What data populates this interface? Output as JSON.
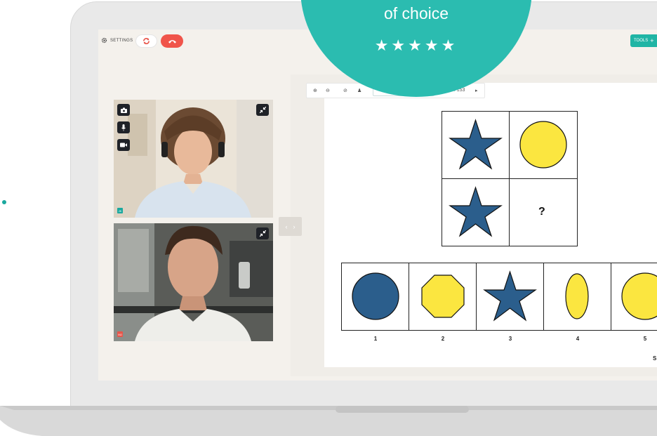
{
  "badge": {
    "text": "of choice",
    "stars": "★★★★★"
  },
  "topbar": {
    "settings_label": "SETTINGS",
    "tools_label": "TOOLS",
    "tools_plus": "+"
  },
  "participants": [
    {
      "initials": "JK",
      "initials_color": "#1aa89e"
    },
    {
      "initials": "MJ",
      "initials_color": "#e8564b"
    }
  ],
  "toolbar": {
    "page_counter": "1 / 153",
    "next_arrow": "▸"
  },
  "nav": {
    "prev": "‹",
    "next": "›"
  },
  "puzzle": {
    "question_mark": "?",
    "answers": [
      "1",
      "2",
      "3",
      "4",
      "5"
    ],
    "page_label": "S"
  },
  "colors": {
    "accent": "#2bbcb0",
    "hangup": "#f0544a",
    "star_blue": "#2b5e8c",
    "shape_yellow": "#fbe640"
  }
}
